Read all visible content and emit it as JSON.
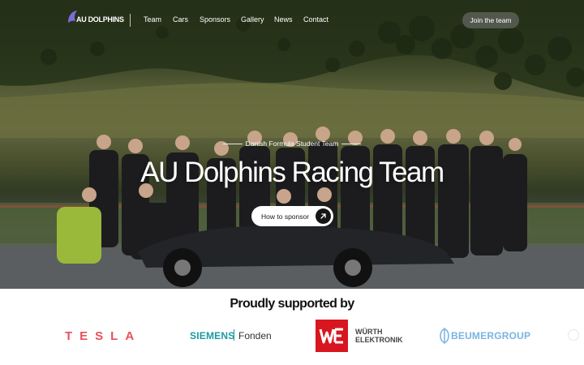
{
  "brand": {
    "logo_text": "AU DOLPHINS"
  },
  "nav": {
    "links": [
      "Team",
      "Cars",
      "Sponsors",
      "Gallery",
      "News",
      "Contact"
    ],
    "cta_label": "Join the team"
  },
  "hero": {
    "eyebrow": "Danish Formula Student Team",
    "title": "AU Dolphins Racing Team",
    "button_label": "How to sponsor",
    "button_icon": "arrow-up-right-icon"
  },
  "supporters": {
    "title": "Proudly supported by",
    "logos": {
      "tesla": "TESLA",
      "siemens": "SIEMENS",
      "fonden": "Fonden",
      "wurth_line1": "WÜRTH",
      "wurth_line2": "ELEKTRONIK",
      "beumer": "BEUMERGROUP"
    }
  },
  "colors": {
    "tesla": "#e8505b",
    "siemens": "#1b9aa0",
    "wurth": "#d7161f",
    "beumer": "#79b4e0",
    "logo_accent": "#7b6cd9"
  }
}
